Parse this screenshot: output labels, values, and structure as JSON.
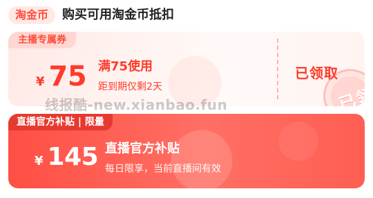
{
  "header": {
    "coin_label": "淘金币",
    "title": "购买可用淘金币抵扣"
  },
  "coupons": [
    {
      "badge": "主播专属券",
      "currency": "¥",
      "amount": "75",
      "title": "满75使用",
      "subtitle": "距到期仅剩2天",
      "action": "已领取",
      "stamp": "已领"
    },
    {
      "badge": "直播官方补贴 | 限量",
      "currency": "¥",
      "amount": "145",
      "title": "直播官方补贴",
      "subtitle": "每日限享，当前直播间有效"
    }
  ],
  "watermark": "线报酷-new.xianbao.fun",
  "colors": {
    "accent": "#ff3b2a",
    "pill_bg": "#ffe9e6",
    "coupon1_bg": "#fff4f2",
    "coupon2_bg": "#ff5e53"
  }
}
